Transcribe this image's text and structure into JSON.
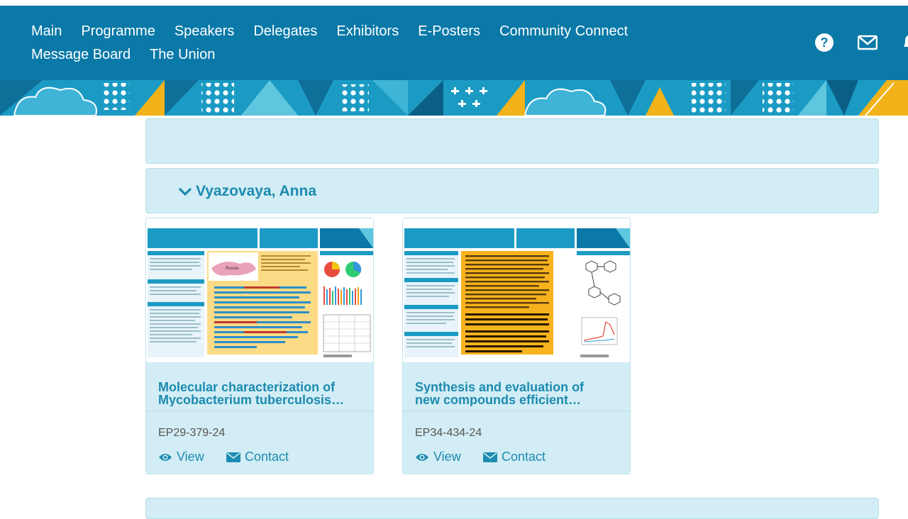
{
  "nav": {
    "row1": [
      "Main",
      "Programme",
      "Speakers",
      "Delegates",
      "Exhibitors",
      "E-Posters",
      "Community Connect"
    ],
    "row2": [
      "Message Board",
      "The Union"
    ],
    "icons": [
      "help-icon",
      "mail-icon",
      "notification-icon"
    ]
  },
  "empty_panel": {},
  "author": {
    "name": "Vyazovaya, Anna",
    "toggle_icon": "chevron-down-icon"
  },
  "posters": [
    {
      "title_line1": "Molecular characterization of",
      "title_line2": "Mycobacterium tuberculosis…",
      "code": "EP29-379-24",
      "view_label": "View",
      "contact_label": "Contact",
      "thumb": {
        "header": "Molecular characterization of Mycobacterium tuberculosis isolates in the Russian region with unexpectedly low TB incidence",
        "badge": "The European TB experience",
        "code": "E-Poster No. EP29-379-24",
        "conference": "THE 51ST UNION WORLD CONFERENCE ON LUNG HEALTH",
        "map_label": "Russia",
        "highlight": "The M. tuberculosis population in Vologda region (Russian region with low TB incidence) is dominated by the Beijing genotype (as elsewhere in Russia), but the prevalence rate of the Russian epidemic clone B0/W148 is 1.5-2-fold lower than in the neighboring provinces. On the other hand, circulation of the resistant Central Asia Outbreak strain is higher than in other Russian regions and warrants close monitoring and analysis of routes of its importation here."
      }
    },
    {
      "title_line1": "Synthesis and evaluation of",
      "title_line2": "new compounds efficient…",
      "code": "EP34-434-24",
      "view_label": "View",
      "contact_label": "Contact",
      "thumb": {
        "header": "Synthesis and evaluation of new compounds efficient against Mycobacterium tuberculosis isolates circulating in high-burden country, Russian Federation",
        "badge": "TB: From bench to the bedside",
        "code": "E-Poster No. EP34-434-24",
        "conference": "THE 51ST UNION WORLD CONFERENCE ON LUNG HEALTH",
        "highlight": "Compounds DM-1448, DM-1468, CB-0514 and CB-844 were selected for further testing for cytotoxicity and activity against different strains of M. tuberculosis. The most efficient compound showed a wide range of MIC from 3.1 µg/ml to 100 µg/ml. In view of the high MIC variation, new anti-TB compounds should be evaluated with clinical isolates from different areas and lineages/clusters of M. tuberculosis, especially in TB high-burden countries."
      }
    }
  ],
  "colors": {
    "navbar": "#0a79a8",
    "panel": "#d2edf5",
    "accent_text": "#1d8bb0",
    "banner_blue": "#1b9bc4",
    "banner_yellow": "#f2b21a"
  }
}
